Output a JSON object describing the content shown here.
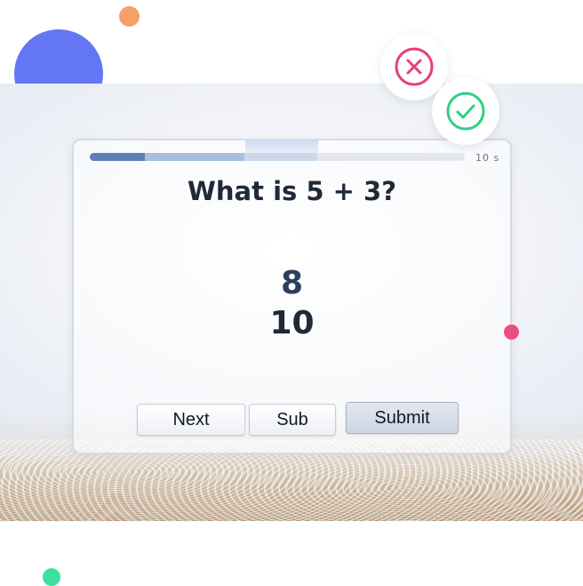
{
  "quiz": {
    "timer": "10 s",
    "progress": 0.61,
    "question": "What is 5 + 3?",
    "answers": [
      "8",
      "10"
    ]
  },
  "buttons": {
    "next": "Next",
    "sub": "Sub",
    "submit": "Submit"
  },
  "badges": {
    "wrong_icon": "close-circle-icon",
    "correct_icon": "check-circle-icon",
    "wrong_color": "#e83f72",
    "correct_color": "#2ecf84"
  },
  "colors": {
    "accent_blue": "#6377f5",
    "orange": "#f4a068",
    "pink": "#ec4f7d",
    "green": "#3ee0a0",
    "progress": "#5b7fb8"
  }
}
